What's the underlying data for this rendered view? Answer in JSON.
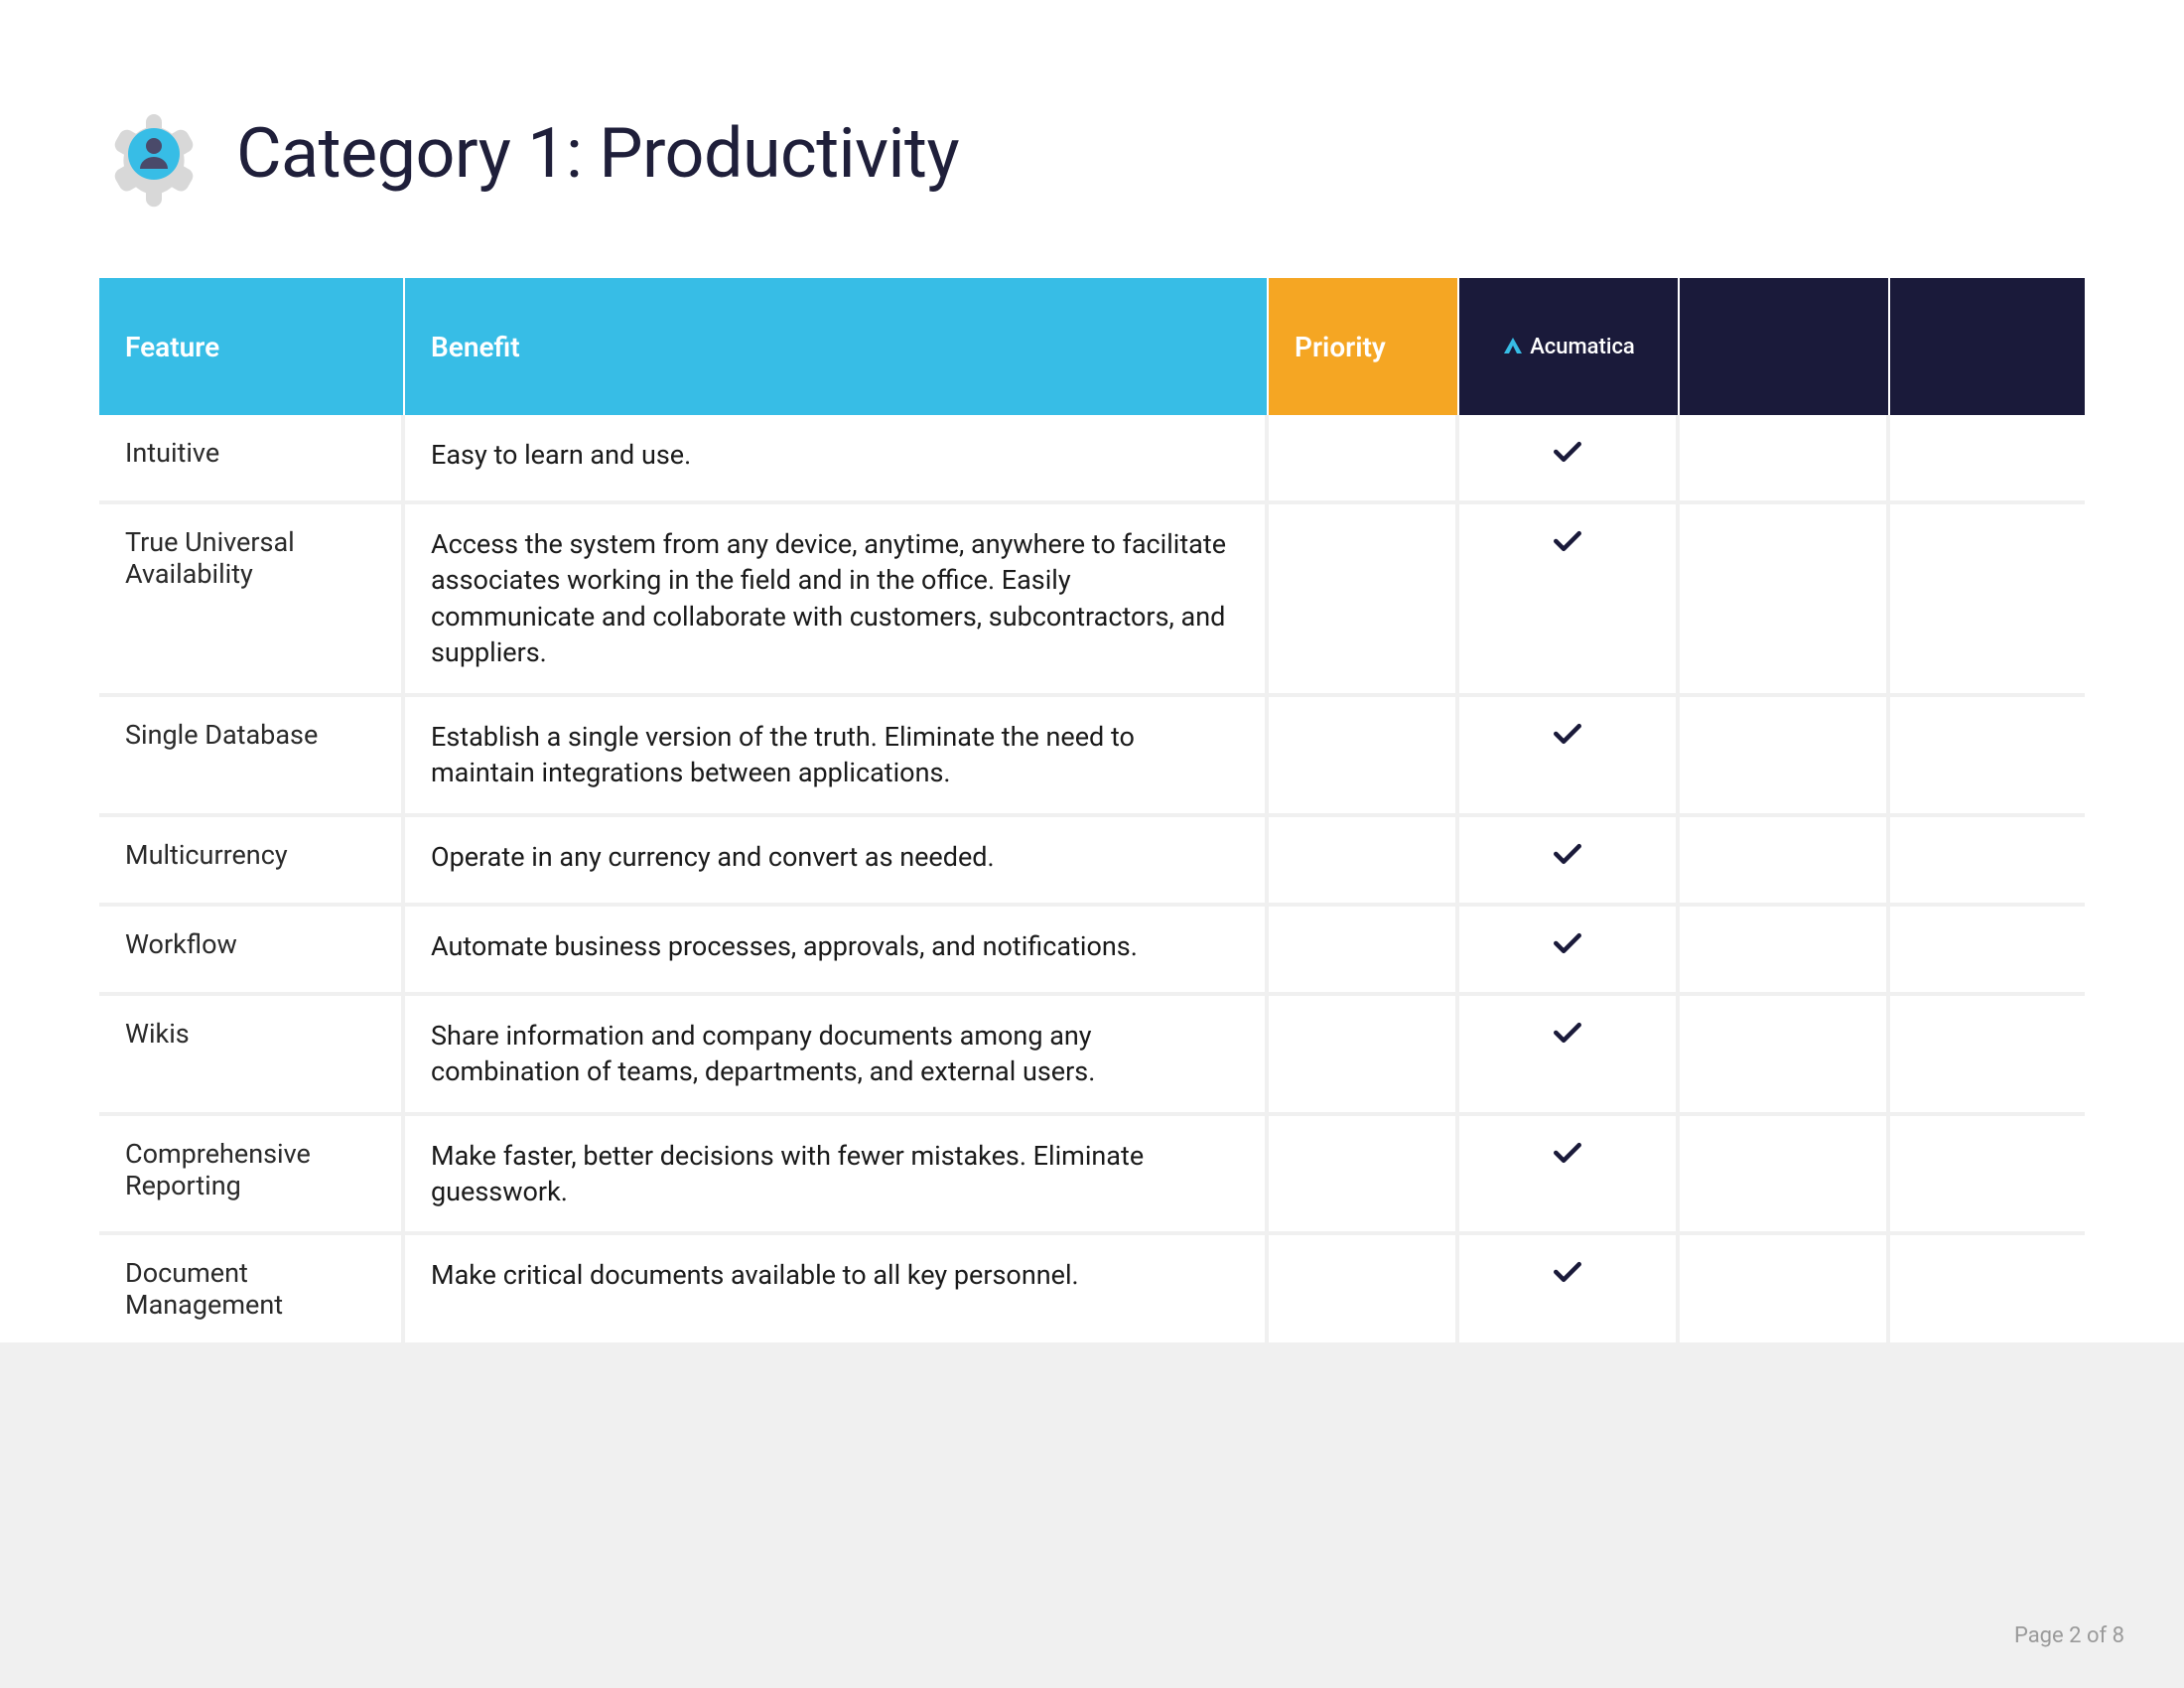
{
  "title": "Category 1: Productivity",
  "columns": {
    "feature": "Feature",
    "benefit": "Benefit",
    "priority": "Priority",
    "vendor": "Acumatica"
  },
  "rows": [
    {
      "feature": "Intuitive",
      "benefit": "Easy to learn and use.",
      "checked": true
    },
    {
      "feature": "True Universal Availability",
      "benefit": "Access the system from any device, anytime, anywhere to facilitate associates working in the field and in the office. Easily communicate and collaborate with customers, subcontractors, and suppliers.",
      "checked": true
    },
    {
      "feature": "Single Database",
      "benefit": "Establish a single version of the truth. Eliminate the need to maintain integrations between applications.",
      "checked": true
    },
    {
      "feature": "Multicurrency",
      "benefit": "Operate in any currency and convert as needed.",
      "checked": true
    },
    {
      "feature": "Workflow",
      "benefit": "Automate business processes, approvals, and notifications.",
      "checked": true
    },
    {
      "feature": "Wikis",
      "benefit": "Share information and company documents among any combination of teams, departments, and external users.",
      "checked": true
    },
    {
      "feature": "Comprehensive Reporting",
      "benefit": "Make faster, better decisions with fewer mistakes. Eliminate guesswork.",
      "checked": true
    },
    {
      "feature": "Document Management",
      "benefit": "Make critical documents available to all key personnel.",
      "checked": true
    }
  ],
  "footer": "Page 2 of 8"
}
